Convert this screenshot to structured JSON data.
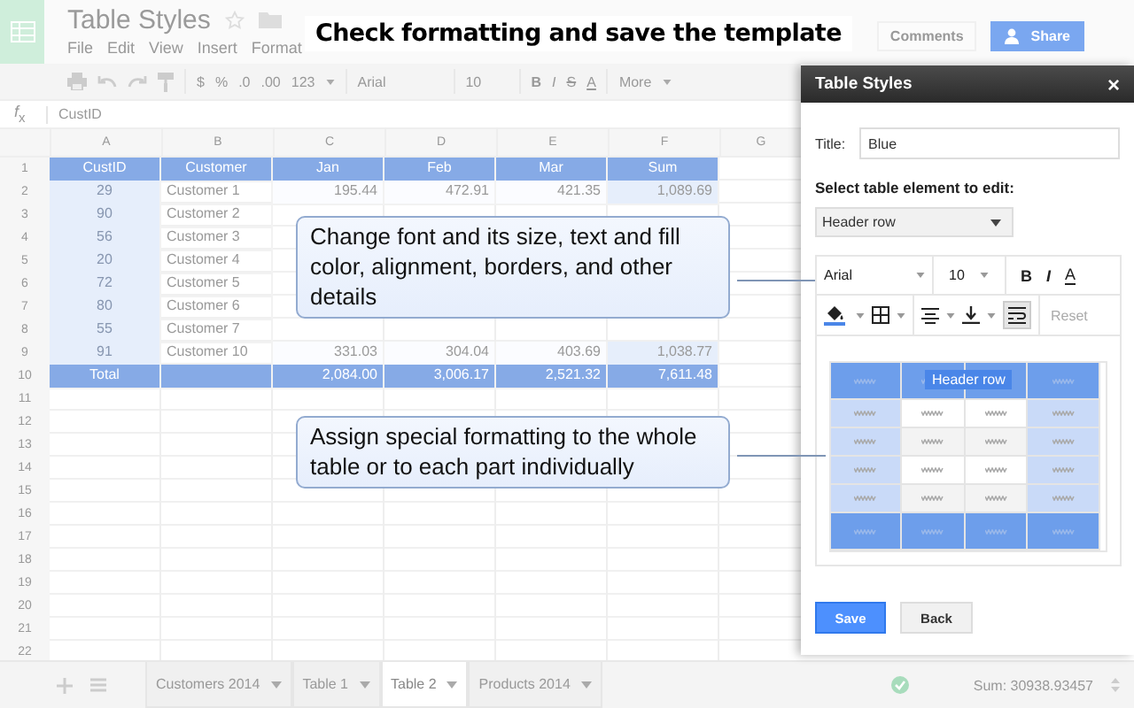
{
  "app": {
    "title": "Table Styles",
    "menu": [
      "File",
      "Edit",
      "View",
      "Insert",
      "Format"
    ],
    "comments": "Comments",
    "share": "Share"
  },
  "heading": "Check formatting and save the template",
  "toolbar": {
    "formats": [
      "$",
      "%",
      ".0",
      ".00"
    ],
    "number_format": "123",
    "font": "Arial",
    "font_size": "10",
    "styles": [
      "B",
      "I",
      "S",
      "A"
    ],
    "more": "More"
  },
  "formula_bar": {
    "label": "*f*$_{x}$",
    "value": "CustID"
  },
  "sheet": {
    "columns": [
      "A",
      "B",
      "C",
      "D",
      "E",
      "F",
      "G"
    ],
    "rows": [
      {
        "number": "1",
        "kind": "header",
        "cells": [
          "CustID",
          "Customer",
          "Jan",
          "Feb",
          "Mar",
          "Sum"
        ]
      },
      {
        "number": "2",
        "kind": "data",
        "cells": [
          "29",
          "Customer 1",
          "195.44",
          "472.91",
          "421.35",
          "1,089.69"
        ]
      },
      {
        "number": "3",
        "kind": "data",
        "cells": [
          "90",
          "Customer 2"
        ]
      },
      {
        "number": "4",
        "kind": "data",
        "cells": [
          "56",
          "Customer 3"
        ]
      },
      {
        "number": "5",
        "kind": "data",
        "cells": [
          "20",
          "Customer 4"
        ]
      },
      {
        "number": "6",
        "kind": "data",
        "cells": [
          "72",
          "Customer 5"
        ]
      },
      {
        "number": "7",
        "kind": "data",
        "cells": [
          "80",
          "Customer 6"
        ]
      },
      {
        "number": "8",
        "kind": "data",
        "cells": [
          "55",
          "Customer 7"
        ]
      },
      {
        "number": "9",
        "kind": "data",
        "cells": [
          "91",
          "Customer 10",
          "331.03",
          "304.04",
          "403.69",
          "1,038.77"
        ]
      },
      {
        "number": "10",
        "kind": "total",
        "cells": [
          "Total",
          null,
          "2,084.00",
          "3,006.17",
          "2,521.32",
          "7,611.48"
        ]
      },
      {
        "number": "11",
        "kind": "empty"
      },
      {
        "number": "12",
        "kind": "empty"
      },
      {
        "number": "13",
        "kind": "empty"
      },
      {
        "number": "14",
        "kind": "empty"
      },
      {
        "number": "15",
        "kind": "empty"
      },
      {
        "number": "16",
        "kind": "empty"
      },
      {
        "number": "17",
        "kind": "empty"
      },
      {
        "number": "18",
        "kind": "empty"
      },
      {
        "number": "19",
        "kind": "empty"
      },
      {
        "number": "20",
        "kind": "empty"
      },
      {
        "number": "21",
        "kind": "empty"
      },
      {
        "number": "22",
        "kind": "empty"
      }
    ]
  },
  "callouts": [
    "Change font and its size, text and fill color, alignment, borders, and other details",
    "Assign special formatting to the whole table or to each part individually"
  ],
  "panel": {
    "title": "Table Styles",
    "close": "×",
    "title_label": "Title:",
    "title_value": "Blue",
    "select_label": "Select table element to edit:",
    "element": "Header row",
    "format_toolbar": {
      "font": "Arial",
      "font_size": "10",
      "styles": [
        "B",
        "I",
        "A"
      ],
      "wrap_on": true,
      "reset": "Reset"
    },
    "preview_label": "Header row",
    "save": "Save",
    "back": "Back"
  },
  "sheet_tabs": [
    {
      "label": "Customers 2014",
      "selected": false
    },
    {
      "label": "Table 1",
      "selected": false
    },
    {
      "label": "Table 2",
      "selected": true
    },
    {
      "label": "Products 2014",
      "selected": false
    }
  ],
  "status": {
    "sum": "Sum: 30938.93457"
  }
}
